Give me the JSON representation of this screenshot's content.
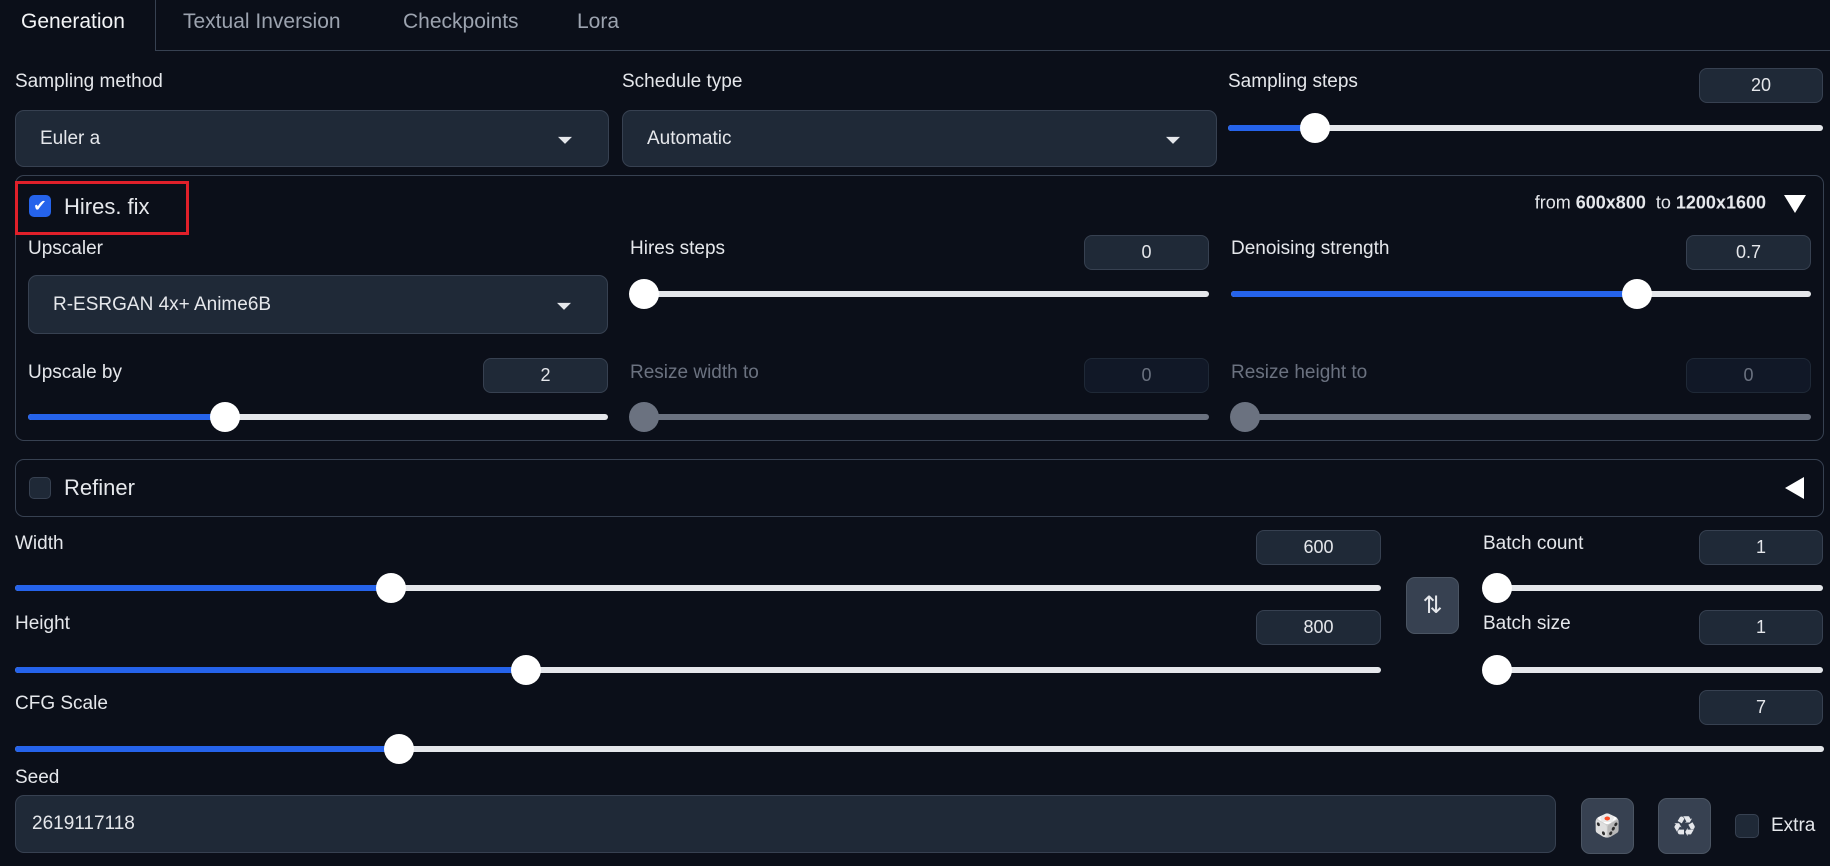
{
  "tabs": [
    {
      "label": "Generation",
      "active": true
    },
    {
      "label": "Textual Inversion"
    },
    {
      "label": "Checkpoints"
    },
    {
      "label": "Lora"
    }
  ],
  "sampling_method": {
    "label": "Sampling method",
    "value": "Euler a"
  },
  "schedule_type": {
    "label": "Schedule type",
    "value": "Automatic"
  },
  "sampling_steps": {
    "label": "Sampling steps",
    "value": "20",
    "fraction": 0.146
  },
  "hires": {
    "label": "Hires. fix",
    "checked": true,
    "summary_from": "from",
    "from_size": "600x800",
    "summary_to": "to",
    "to_size": "1200x1600",
    "upscaler": {
      "label": "Upscaler",
      "value": "R-ESRGAN 4x+ Anime6B"
    },
    "hires_steps": {
      "label": "Hires steps",
      "value": "0",
      "fraction": 0
    },
    "denoising": {
      "label": "Denoising strength",
      "value": "0.7",
      "fraction": 0.7
    },
    "upscale_by": {
      "label": "Upscale by",
      "value": "2",
      "fraction": 0.34
    },
    "resize_width": {
      "label": "Resize width to",
      "value": "0",
      "fraction": 0
    },
    "resize_height": {
      "label": "Resize height to",
      "value": "0",
      "fraction": 0
    }
  },
  "refiner": {
    "label": "Refiner",
    "checked": false
  },
  "width": {
    "label": "Width",
    "value": "600",
    "fraction": 0.275
  },
  "height": {
    "label": "Height",
    "value": "800",
    "fraction": 0.374
  },
  "swap_icon": "⇅",
  "batch_count": {
    "label": "Batch count",
    "value": "1",
    "fraction": 0
  },
  "batch_size": {
    "label": "Batch size",
    "value": "1",
    "fraction": 0
  },
  "cfg_scale": {
    "label": "CFG Scale",
    "value": "7",
    "fraction": 0.212
  },
  "seed": {
    "label": "Seed",
    "value": "2619117118"
  },
  "dice_icon": "🎲",
  "recycle_icon": "♻",
  "extra": {
    "label": "Extra",
    "checked": false
  },
  "colors": {
    "accent": "#2563eb",
    "background": "#0b0f19",
    "input": "#1f2937",
    "highlight": "#e0202a"
  }
}
